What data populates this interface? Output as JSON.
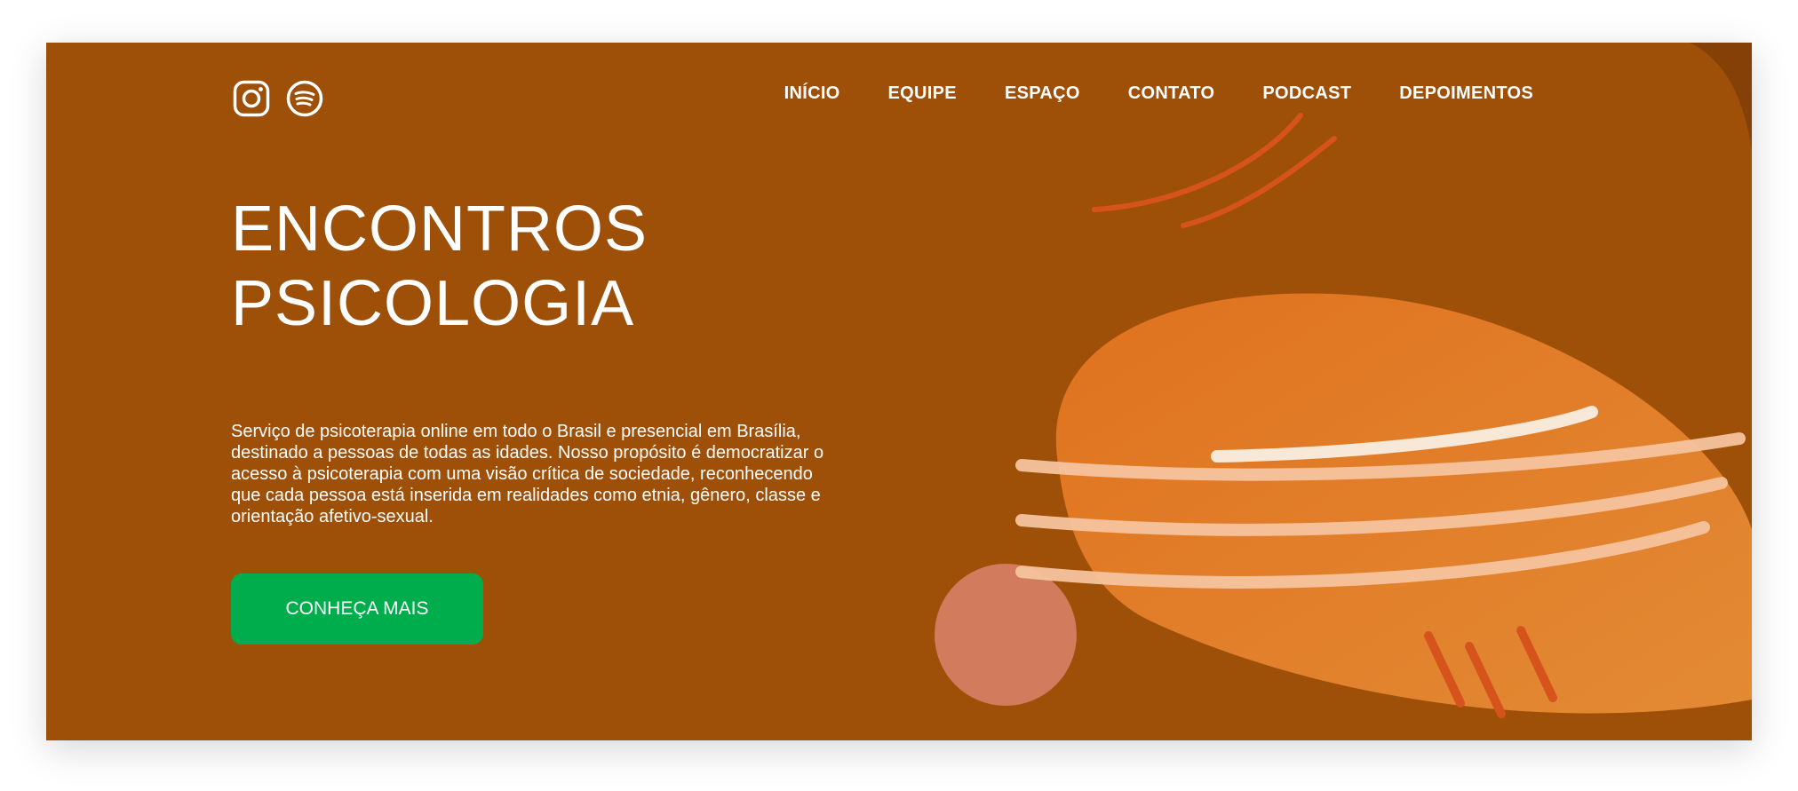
{
  "social": {
    "instagram_icon": "instagram-icon",
    "spotify_icon": "spotify-icon"
  },
  "nav": {
    "items": [
      {
        "label": "INÍCIO"
      },
      {
        "label": "EQUIPE"
      },
      {
        "label": "ESPAÇO"
      },
      {
        "label": "CONTATO"
      },
      {
        "label": "PODCAST"
      },
      {
        "label": "DEPOIMENTOS"
      }
    ]
  },
  "hero": {
    "title_line1": "ENCONTROS",
    "title_line2": "PSICOLOGIA",
    "description": "Serviço de psicoterapia online em todo o Brasil e presencial em Brasília, destinado a pessoas de todas as idades. Nosso propósito é democratizar o acesso à psicoterapia com uma visão crítica de sociedade, reconhecendo que cada pessoa está inserida em realidades como etnia, gênero, classe e orientação afetivo-sexual.",
    "cta_label": "CONHEÇA MAIS"
  },
  "colors": {
    "background": "#9e4f08",
    "corner": "#854008",
    "blob": "#e0721e",
    "circle": "#d27c5d",
    "cta": "#00ad4c",
    "arcs": "#d6541c"
  }
}
